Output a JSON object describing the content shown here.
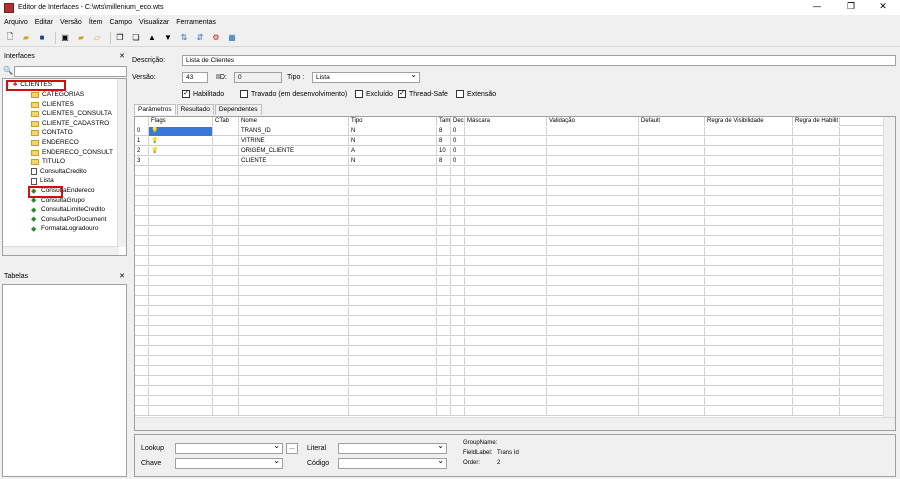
{
  "window": {
    "title": "Editor de Interfaces - C:\\wts\\millenium_eco.wts",
    "min": "—",
    "max": "❐",
    "close": "✕"
  },
  "menu": [
    "Arquivo",
    "Editar",
    "Versão",
    "Ítem",
    "Campo",
    "Visualizar",
    "Ferramentas"
  ],
  "left": {
    "interfaces_title": "Interfaces",
    "close": "✕",
    "root": "CLIENTES",
    "items": [
      {
        "label": "CATEGORIAS",
        "icon": "folder"
      },
      {
        "label": "CLIENTES",
        "icon": "folder"
      },
      {
        "label": "CLIENTES_CONSULTA",
        "icon": "folder"
      },
      {
        "label": "CLIENTE_CADASTRO",
        "icon": "folder"
      },
      {
        "label": "CONTATO",
        "icon": "folder"
      },
      {
        "label": "ENDERECO",
        "icon": "folder"
      },
      {
        "label": "ENDERECO_CONSULT",
        "icon": "folder"
      },
      {
        "label": "TITULO",
        "icon": "folder"
      },
      {
        "label": "ConsultaCredito",
        "icon": "sheet"
      },
      {
        "label": "Lista",
        "icon": "sheet"
      },
      {
        "label": "ConsultaEndereco",
        "icon": "leaf"
      },
      {
        "label": "ConsultaGrupo",
        "icon": "leaf"
      },
      {
        "label": "ConsultaLimiteCredito",
        "icon": "leaf"
      },
      {
        "label": "ConsultaPorDocument",
        "icon": "leaf"
      },
      {
        "label": "FormataLogradouro",
        "icon": "leaf"
      }
    ],
    "tabelas_title": "Tabelas"
  },
  "form": {
    "descricao_label": "Descrição:",
    "descricao_value": "Lista de Clientes",
    "versao_label": "Versão:",
    "versao_value": "43",
    "iid_label": "IID:",
    "iid_value": "0",
    "tipo_label": "Tipo :",
    "tipo_value": "Lista",
    "habilitado": "Habilitado",
    "travado": "Travado (em desenvolvimento)",
    "excluido": "Excluído",
    "threadsafe": "Thread-Safe",
    "extensao": "Extensão"
  },
  "tabs": [
    "Parâmetros",
    "Resultado",
    "Dependentes"
  ],
  "grid": {
    "columns": [
      "Flags",
      "CTab",
      "Nome",
      "Tipo",
      "Taman",
      "Decima",
      "Máscara",
      "Validação",
      "Default",
      "Regra de Visibilidade",
      "Regra de Habilit"
    ],
    "rows": [
      {
        "idx": "0",
        "nome": "TRANS_ID",
        "tipo": "N",
        "tam": "8",
        "dec": "0"
      },
      {
        "idx": "1",
        "nome": "VITRINE",
        "tipo": "N",
        "tam": "8",
        "dec": "0"
      },
      {
        "idx": "2",
        "nome": "ORIGEM_CLIENTE",
        "tipo": "A",
        "tam": "10",
        "dec": "0"
      },
      {
        "idx": "3",
        "nome": "CLIENTE",
        "tipo": "N",
        "tam": "8",
        "dec": "0"
      }
    ]
  },
  "bottom": {
    "lookup": "Lookup",
    "chave": "Chave",
    "literal": "Literal",
    "codigo": "Código",
    "dots": "...",
    "groupname_label": "GroupName:",
    "fieldlabel_label": "FieldLabel:",
    "fieldlabel_value": "Trans Id",
    "order_label": "Order:",
    "order_value": "2"
  }
}
